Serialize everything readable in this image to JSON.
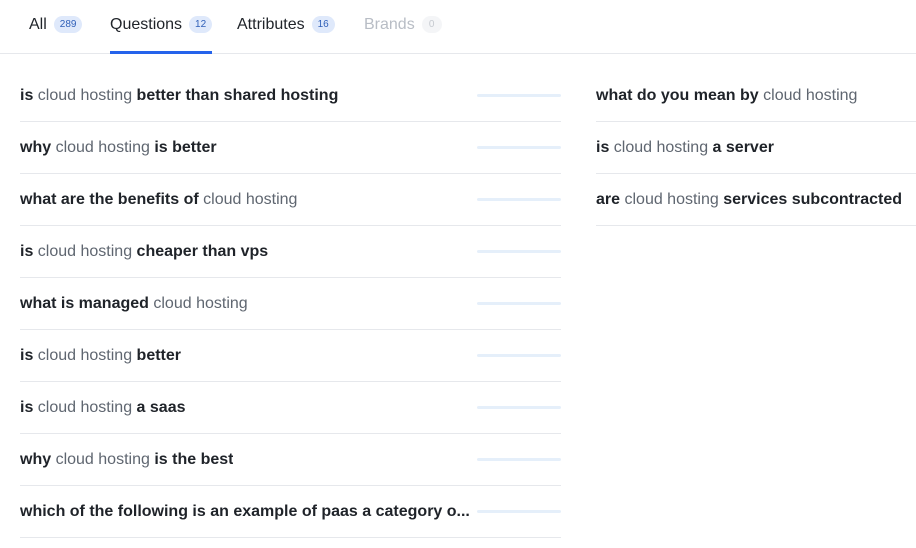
{
  "tabs": [
    {
      "label": "All",
      "count": "289"
    },
    {
      "label": "Questions",
      "count": "12"
    },
    {
      "label": "Attributes",
      "count": "16"
    },
    {
      "label": "Brands",
      "count": "0"
    }
  ],
  "left_column": [
    {
      "prefix": "is",
      "keyword": "cloud hosting",
      "suffix": "better than shared hosting",
      "volume": 0
    },
    {
      "prefix": "why",
      "keyword": "cloud hosting",
      "suffix": "is better",
      "volume": 0
    },
    {
      "prefix": "what are the benefits of",
      "keyword": "cloud hosting",
      "suffix": "",
      "volume": 0
    },
    {
      "prefix": "is",
      "keyword": "cloud hosting",
      "suffix": "cheaper than vps",
      "volume": 0
    },
    {
      "prefix": "what is managed",
      "keyword": "cloud hosting",
      "suffix": "",
      "volume": 0
    },
    {
      "prefix": "is",
      "keyword": "cloud hosting",
      "suffix": "better",
      "volume": 0
    },
    {
      "prefix": "is",
      "keyword": "cloud hosting",
      "suffix": "a saas",
      "volume": 0
    },
    {
      "prefix": "why",
      "keyword": "cloud hosting",
      "suffix": "is the best",
      "volume": 0
    },
    {
      "prefix": "which of the following is an example of paas a category o...",
      "keyword": "",
      "suffix": "",
      "volume": 0
    }
  ],
  "right_column": [
    {
      "prefix": "what do you mean by",
      "keyword": "cloud hosting",
      "suffix": ""
    },
    {
      "prefix": "is",
      "keyword": "cloud hosting",
      "suffix": "a server"
    },
    {
      "prefix": "are",
      "keyword": "cloud hosting",
      "suffix": "services subcontracted"
    }
  ]
}
